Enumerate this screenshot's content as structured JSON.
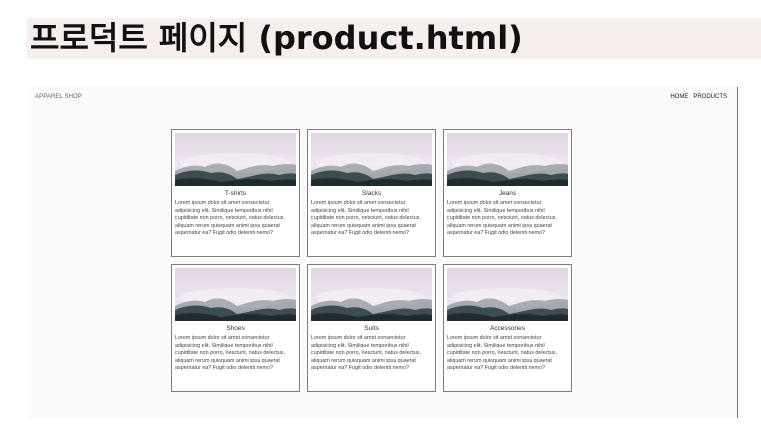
{
  "heading": {
    "text": "프로덕트 페이지 (product.html)"
  },
  "site": {
    "brand": "APPAREL SHOP",
    "nav": [
      {
        "label": "HOME"
      },
      {
        "label": "PRODUCTS"
      }
    ]
  },
  "products": [
    {
      "title": "T-shirts",
      "description": "Lorem ipsum dolor sit amet consectetur adipisicing elit. Similique temporibus nihil cupiditate non porro, nesciunt, natus delectus, aliquam rerum quisquam animi ipsa quaerat aspernatur ea? Fugit odio deleniti nemo?"
    },
    {
      "title": "Slacks",
      "description": "Lorem ipsum dolor sit amet consectetur adipisicing elit. Similique temporibus nihil cupiditate non porro, nesciunt, natus delectus, aliquam rerum quisquam animi ipsa quaerat aspernatur ea? Fugit odio deleniti nemo?"
    },
    {
      "title": "Jeans",
      "description": "Lorem ipsum dolor sit amet consectetur adipisicing elit. Similique temporibus nihil cupiditate non porro, nesciunt, natus delectus, aliquam rerum quisquam animi ipsa quaerat aspernatur ea? Fugit odio deleniti nemo?"
    },
    {
      "title": "Shoes",
      "description": "Lorem ipsum dolor sit amet consectetur adipisicing elit. Similique temporibus nihil cupiditate non porro, nesciunt, natus delectus, aliquam rerum quisquam animi ipsa quaerat aspernatur ea? Fugit odio deleniti nemo?"
    },
    {
      "title": "Suits",
      "description": "Lorem ipsum dolor sit amet consectetur adipisicing elit. Similique temporibus nihil cupiditate non porro, nesciunt, natus delectus, aliquam rerum quisquam animi ipsa quaerat aspernatur ea? Fugit odio deleniti nemo?"
    },
    {
      "title": "Accessories",
      "description": "Lorem ipsum dolor sit amet consectetur adipisicing elit. Similique temporibus nihil cupiditate non porro, nesciunt, natus delectus, aliquam rerum quisquam animi ipsa quaerat aspernatur ea? Fugit odio deleniti nemo?"
    }
  ]
}
